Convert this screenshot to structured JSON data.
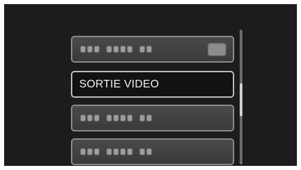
{
  "menu": {
    "items": [
      {
        "label": "",
        "state": "blurred",
        "has_badge": true
      },
      {
        "label": "SORTIE VIDEO",
        "state": "selected"
      },
      {
        "label": "",
        "state": "blurred"
      },
      {
        "label": "",
        "state": "blurred"
      }
    ]
  },
  "scroll": {
    "position": 0.33
  },
  "colors": {
    "background": "#1c1c1c",
    "item_fill": "#444444",
    "item_border": "#8a8a8a",
    "selected_fill": "#121212",
    "text": "#f2f2f2"
  }
}
